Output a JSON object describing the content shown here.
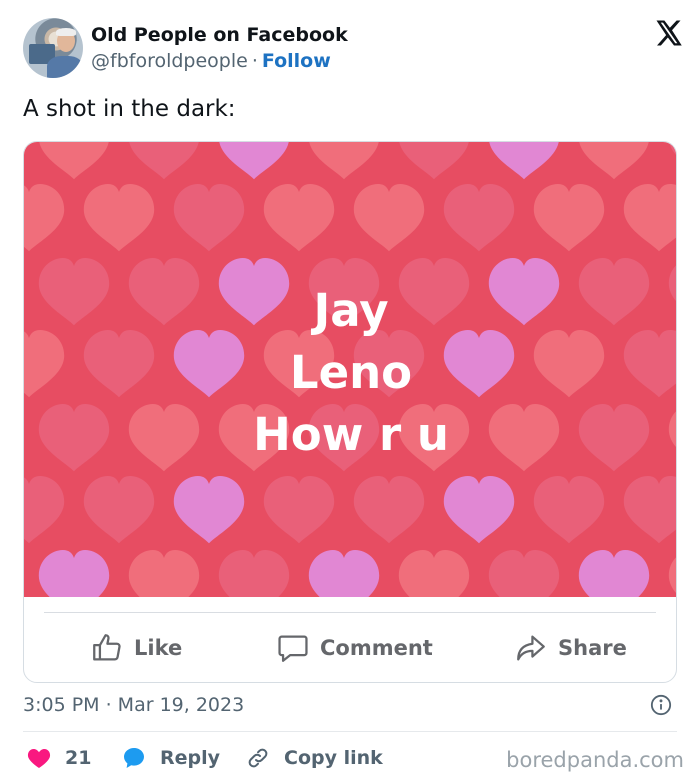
{
  "account": {
    "name": "Old People on Facebook",
    "handle": "@fbforoldpeople",
    "separator": "·",
    "follow_label": "Follow"
  },
  "tweet": {
    "text": "A shot in the dark:",
    "timestamp": "3:05 PM · Mar 19, 2023"
  },
  "facebook_post": {
    "lines": [
      "Jay",
      "Leno",
      "How r u"
    ],
    "background_color": "#e74d62",
    "heart_colors": [
      "#f0707c",
      "#e9617a",
      "#e08ad9"
    ],
    "actions": {
      "like_label": "Like",
      "comment_label": "Comment",
      "share_label": "Share"
    }
  },
  "footer": {
    "like_count": "21",
    "reply_label": "Reply",
    "copy_link_label": "Copy link",
    "watermark": "boredpanda.com"
  },
  "icons": {
    "x_logo": "x-logo-icon",
    "info": "info-icon",
    "heart": "heart-icon",
    "reply": "reply-bubble-icon",
    "link": "link-icon",
    "thumbs_up": "thumbs-up-icon",
    "comment": "comment-icon",
    "share": "share-arrow-icon"
  },
  "colors": {
    "accent_blue": "#1d72c2",
    "like_pink": "#f91880",
    "reply_blue": "#1d9bf0"
  }
}
